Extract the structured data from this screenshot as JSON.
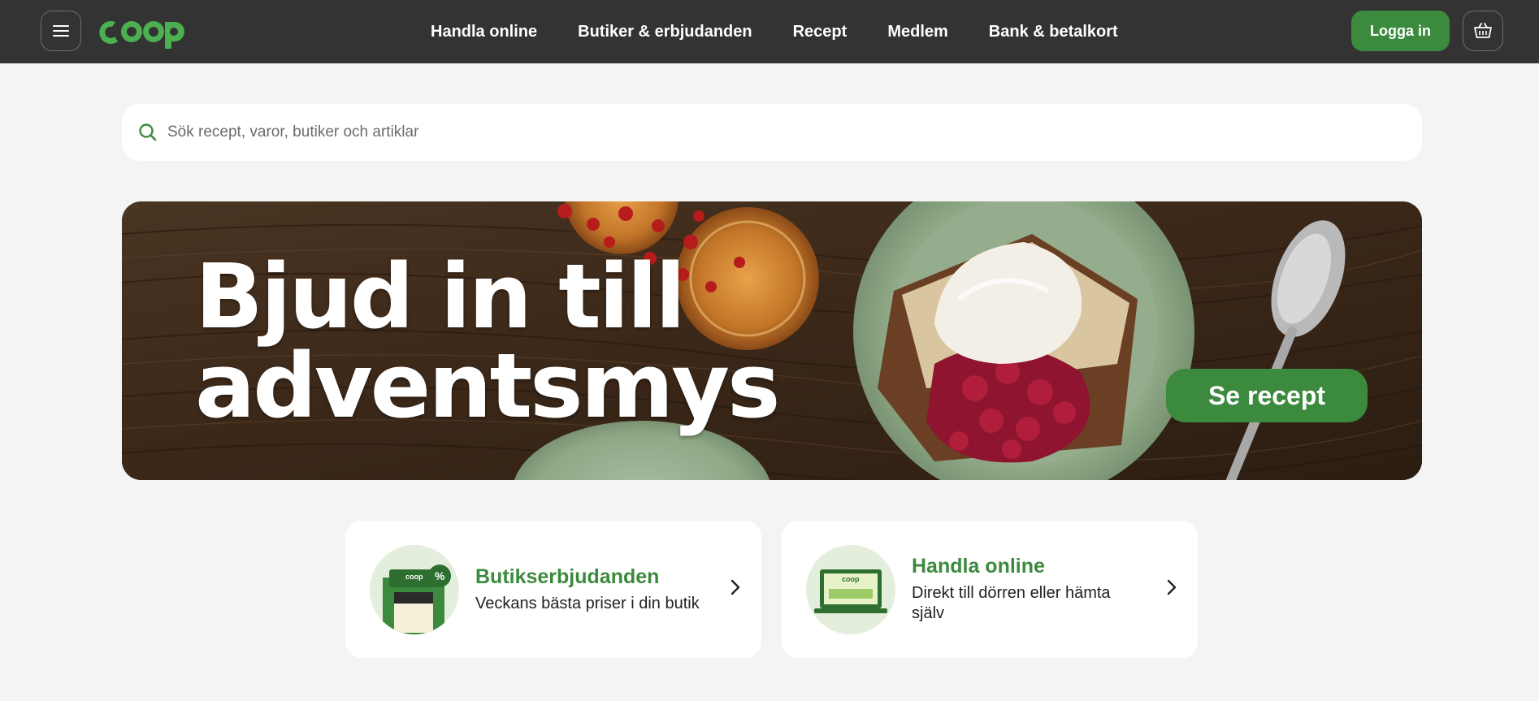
{
  "header": {
    "logo_text": "coop",
    "nav": [
      "Handla online",
      "Butiker & erbjudanden",
      "Recept",
      "Medlem",
      "Bank & betalkort"
    ],
    "login_label": "Logga in"
  },
  "search": {
    "placeholder": "Sök recept, varor, butiker och artiklar"
  },
  "hero": {
    "title_line1": "Bjud in till",
    "title_line2": "adventsmys",
    "cta_label": "Se recept"
  },
  "cards": [
    {
      "title": "Butikserbjudanden",
      "subtitle": "Veckans bästa priser i din butik"
    },
    {
      "title": "Handla online",
      "subtitle_line1": "Direkt till dörren eller hämta",
      "subtitle_line2": "själv"
    }
  ],
  "colors": {
    "header_bg": "#333333",
    "brand_green": "#3b8a3e",
    "logo_green": "#4caf50",
    "page_bg": "#f4f4f4"
  }
}
